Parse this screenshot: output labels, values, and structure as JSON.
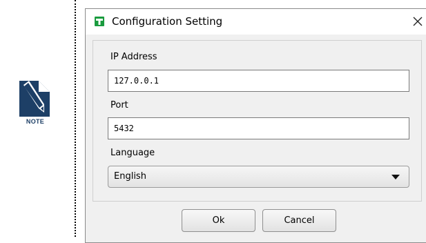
{
  "note": {
    "label": "NOTE",
    "icon": "pencil-note-icon"
  },
  "dialog": {
    "title": "Configuration Setting",
    "app_icon": "green-app-icon",
    "close_icon": "close-icon",
    "fields": {
      "ip_label": "IP Address",
      "ip_value": "127.0.0.1",
      "port_label": "Port",
      "port_value": "5432",
      "language_label": "Language",
      "language_value": "English"
    },
    "buttons": {
      "ok": "Ok",
      "cancel": "Cancel"
    }
  },
  "colors": {
    "app_icon": "#1a9b3e",
    "note_icon": "#1d3f66",
    "dialog_bg": "#f0f0f0"
  }
}
